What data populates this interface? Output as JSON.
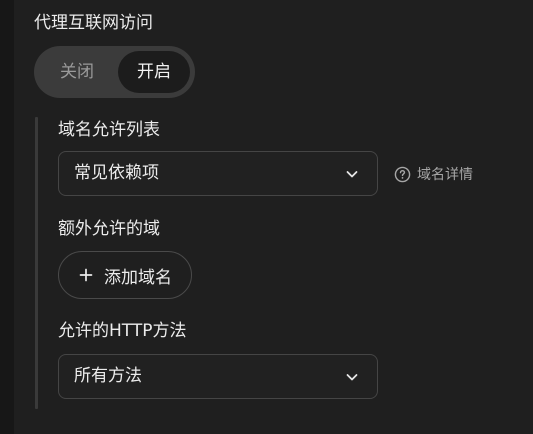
{
  "proxy_section": {
    "title": "代理互联网访问",
    "toggle": {
      "off_label": "关闭",
      "on_label": "开启",
      "selected": "开启"
    }
  },
  "domain_allowlist": {
    "label": "域名允许列表",
    "selected_value": "常见依赖项",
    "help_link": "域名详情",
    "help_icon": "question-circle-icon",
    "dropdown_icon": "chevron-down-icon"
  },
  "extra_domains": {
    "label": "额外允许的域",
    "add_button_label": "添加域名",
    "add_icon": "plus-icon"
  },
  "http_methods": {
    "label": "允许的HTTP方法",
    "selected_value": "所有方法",
    "dropdown_icon": "chevron-down-icon"
  },
  "colors": {
    "background": "#171717",
    "panel": "#1f1f1f",
    "toggle_track": "#3b3b3b",
    "toggle_active": "#1c1c1c",
    "border": "#454545",
    "text": "#ececec",
    "muted_text": "#9a9a9a"
  }
}
